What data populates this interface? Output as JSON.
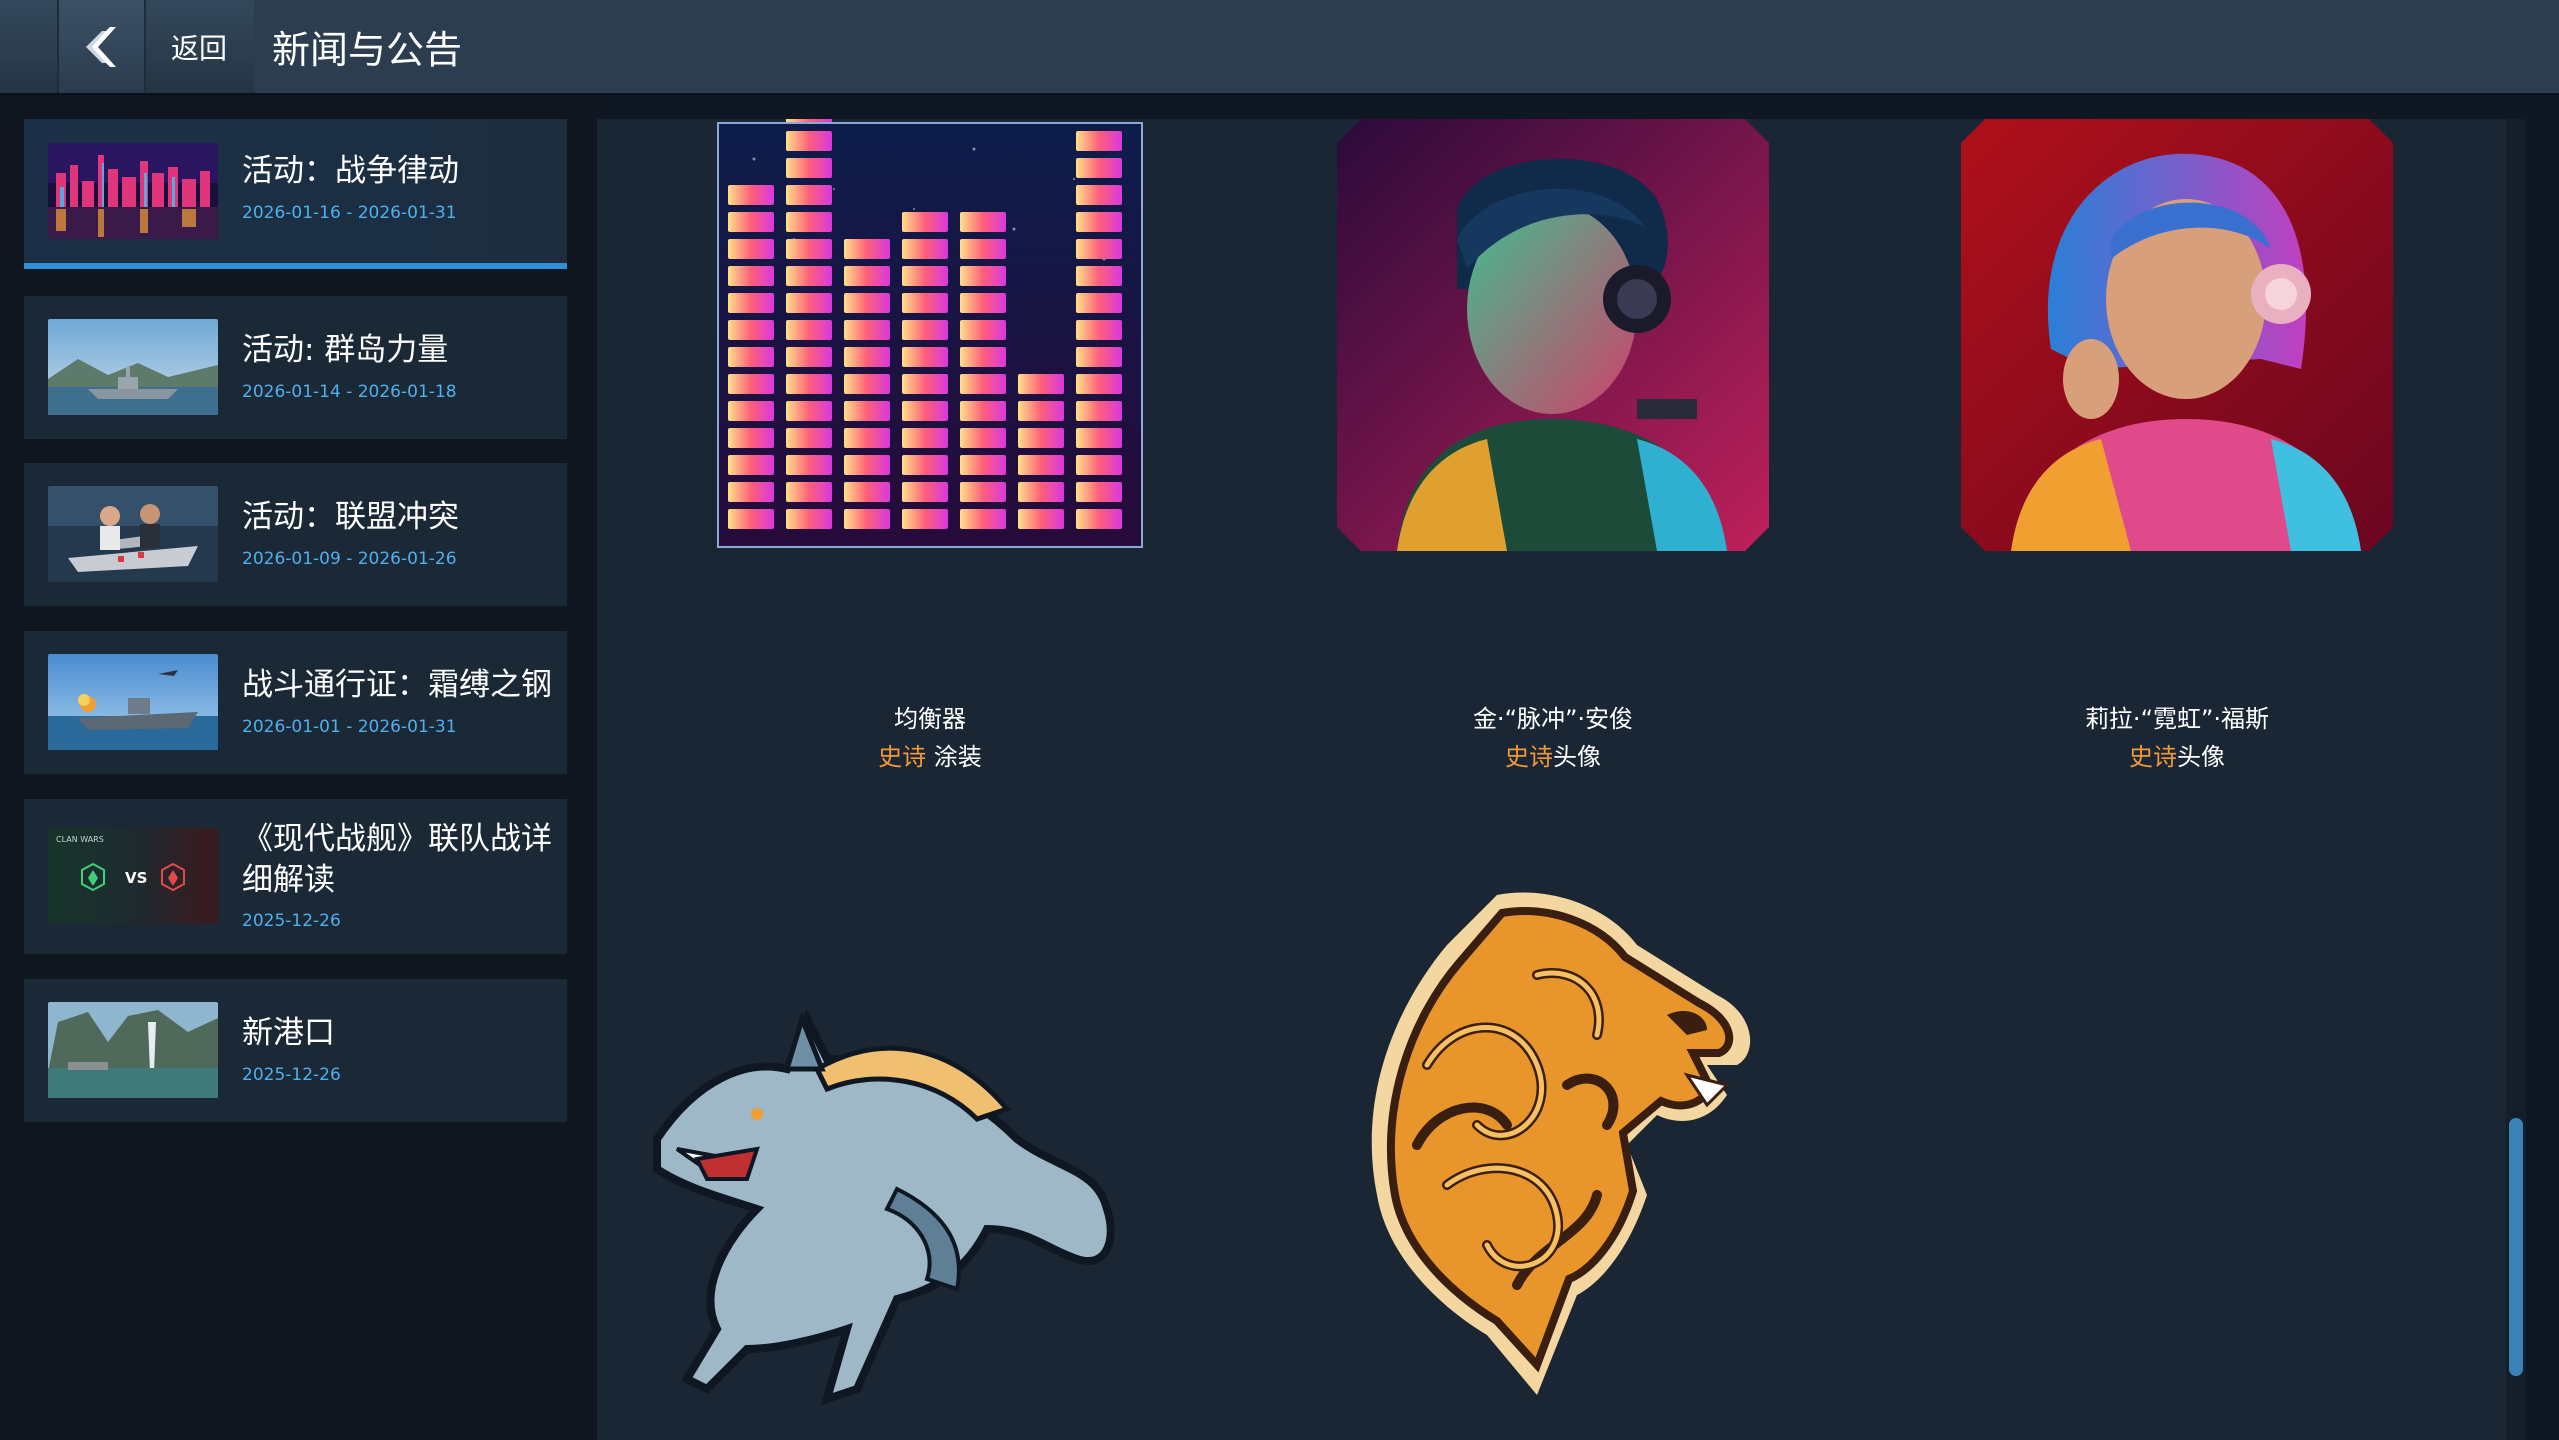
{
  "header": {
    "back_label": "返回",
    "title": "新闻与公告"
  },
  "sidebar": {
    "items": [
      {
        "title": "活动：战争律动",
        "date": "2026-01-16 - 2026-01-31",
        "active": true
      },
      {
        "title": "活动: 群岛力量",
        "date": "2026-01-14 - 2026-01-18",
        "active": false
      },
      {
        "title": "活动：联盟冲突",
        "date": "2026-01-09 - 2026-01-26",
        "active": false
      },
      {
        "title": "战斗通行证：霜缚之钢",
        "date": "2026-01-01 - 2026-01-31",
        "active": false
      },
      {
        "title": "《现代战舰》联队战详细解读",
        "date": "2025-12-26",
        "active": false,
        "thumb_text": "CLAN WARS",
        "thumb_vs": "VS"
      },
      {
        "title": "新港口",
        "date": "2025-12-26",
        "active": false
      }
    ]
  },
  "rewards": [
    {
      "name": "均衡器",
      "rarity": "史诗",
      "type": " 涂装"
    },
    {
      "name": "金·“脉冲”·安俊",
      "rarity": "史诗",
      "type": "头像"
    },
    {
      "name": "莉拉·“霓虹”·福斯",
      "rarity": "史诗",
      "type": "头像"
    }
  ],
  "colors": {
    "accent": "#2f8fd8",
    "date_text": "#4fb0ee",
    "rarity_epic": "#f29a3a",
    "panel_bg": "#1b2634"
  },
  "icons": {
    "back": "chevron-left-icon"
  }
}
